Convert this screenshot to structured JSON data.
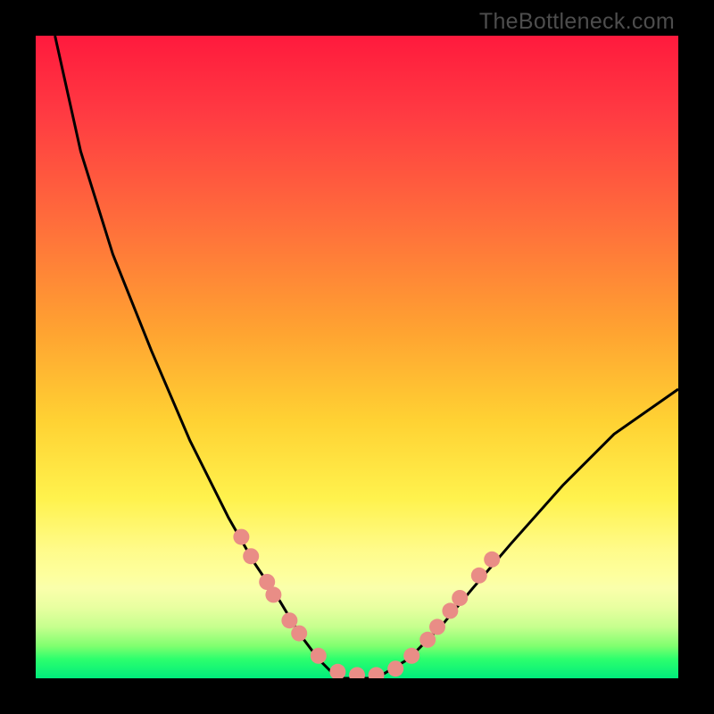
{
  "watermark": "TheBottleneck.com",
  "chart_data": {
    "type": "line",
    "title": "",
    "xlabel": "",
    "ylabel": "",
    "xlim": [
      0,
      100
    ],
    "ylim": [
      0,
      100
    ],
    "note": "Bottleneck-percentage style V-curve over rainbow gradient; axes unlabeled in source image; values estimated from pixel positions.",
    "series": [
      {
        "name": "bottleneck-curve",
        "x": [
          3,
          7,
          12,
          18,
          24,
          30,
          34,
          38,
          41,
          44,
          47,
          53,
          58,
          63,
          68,
          74,
          82,
          90,
          100
        ],
        "y": [
          100,
          82,
          66,
          51,
          37,
          25,
          18,
          12,
          7,
          3,
          0,
          0,
          3,
          8,
          14,
          21,
          30,
          38,
          45
        ]
      }
    ],
    "markers": {
      "name": "highlighted-points",
      "color": "#e98d86",
      "points": [
        {
          "x": 32,
          "y": 22
        },
        {
          "x": 33.5,
          "y": 19
        },
        {
          "x": 36,
          "y": 15
        },
        {
          "x": 37,
          "y": 13
        },
        {
          "x": 39.5,
          "y": 9
        },
        {
          "x": 41,
          "y": 7
        },
        {
          "x": 44,
          "y": 3.5
        },
        {
          "x": 47,
          "y": 1
        },
        {
          "x": 50,
          "y": 0.5
        },
        {
          "x": 53,
          "y": 0.5
        },
        {
          "x": 56,
          "y": 1.5
        },
        {
          "x": 58.5,
          "y": 3.5
        },
        {
          "x": 61,
          "y": 6
        },
        {
          "x": 62.5,
          "y": 8
        },
        {
          "x": 64.5,
          "y": 10.5
        },
        {
          "x": 66,
          "y": 12.5
        },
        {
          "x": 69,
          "y": 16
        },
        {
          "x": 71,
          "y": 18.5
        }
      ]
    }
  }
}
